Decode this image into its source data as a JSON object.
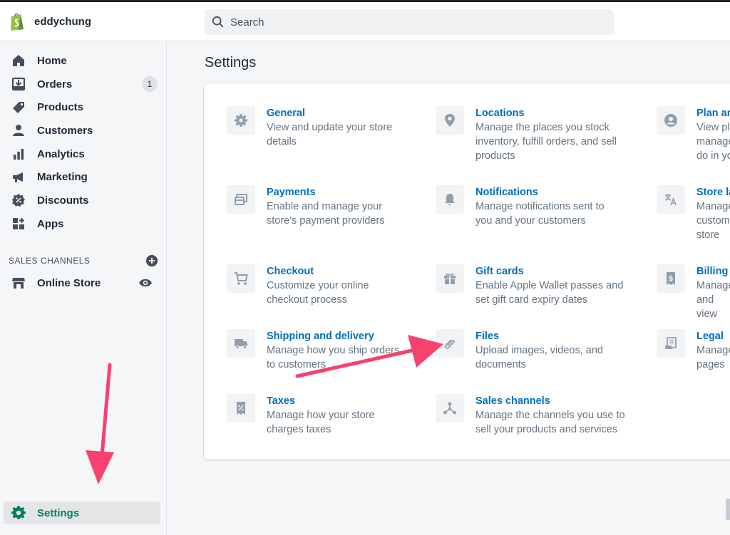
{
  "store": {
    "name": "eddychung"
  },
  "search": {
    "placeholder": "Search"
  },
  "sidebar": {
    "items": [
      {
        "label": "Home",
        "icon": "home-icon"
      },
      {
        "label": "Orders",
        "icon": "orders-icon",
        "badge": "1"
      },
      {
        "label": "Products",
        "icon": "tag-icon"
      },
      {
        "label": "Customers",
        "icon": "person-icon"
      },
      {
        "label": "Analytics",
        "icon": "bar-chart-icon"
      },
      {
        "label": "Marketing",
        "icon": "megaphone-icon"
      },
      {
        "label": "Discounts",
        "icon": "discount-icon"
      },
      {
        "label": "Apps",
        "icon": "apps-icon"
      }
    ],
    "sales_channels": {
      "title": "SALES CHANNELS",
      "online_store": "Online Store"
    },
    "settings": "Settings"
  },
  "page": {
    "title": "Settings"
  },
  "settings": {
    "general": {
      "title": "General",
      "desc_1": "View and update your store",
      "desc_2": "details"
    },
    "locations": {
      "title": "Locations",
      "desc_1": "Manage the places you stock",
      "desc_2": "inventory, fulfill orders, and sell",
      "desc_3": "products"
    },
    "plan": {
      "title": "Plan and permissions",
      "desc_1": "View plan",
      "desc_2": "manage",
      "desc_3": "do in your"
    },
    "payments": {
      "title": "Payments",
      "desc_1": "Enable and manage your",
      "desc_2": "store's payment providers"
    },
    "notifications": {
      "title": "Notifications",
      "desc_1": "Manage notifications sent to",
      "desc_2": "you and your customers"
    },
    "languages": {
      "title": "Store languages",
      "desc_1": "Manage",
      "desc_2": "customers",
      "desc_3": "store"
    },
    "checkout": {
      "title": "Checkout",
      "desc_1": "Customize your online",
      "desc_2": "checkout process"
    },
    "gift_cards": {
      "title": "Gift cards",
      "desc_1": "Enable Apple Wallet passes and",
      "desc_2": "set gift card expiry dates"
    },
    "billing": {
      "title": "Billing",
      "desc_1": "Manage",
      "desc_2": "and view"
    },
    "shipping": {
      "title": "Shipping and delivery",
      "desc_1": "Manage how you ship orders",
      "desc_2": "to customers"
    },
    "files": {
      "title": "Files",
      "desc_1": "Upload images, videos, and",
      "desc_2": "documents"
    },
    "legal": {
      "title": "Legal",
      "desc_1": "Manage",
      "desc_2": "pages"
    },
    "taxes": {
      "title": "Taxes",
      "desc_1": "Manage how your store",
      "desc_2": "charges taxes"
    },
    "sales_channels": {
      "title": "Sales channels",
      "desc_1": "Manage the channels you use to",
      "desc_2": "sell your products and services"
    }
  },
  "colors": {
    "brand_green": "#95bf47",
    "active_green": "#008060",
    "link_blue": "#006fbb",
    "annotation_pink": "#f7416f"
  }
}
